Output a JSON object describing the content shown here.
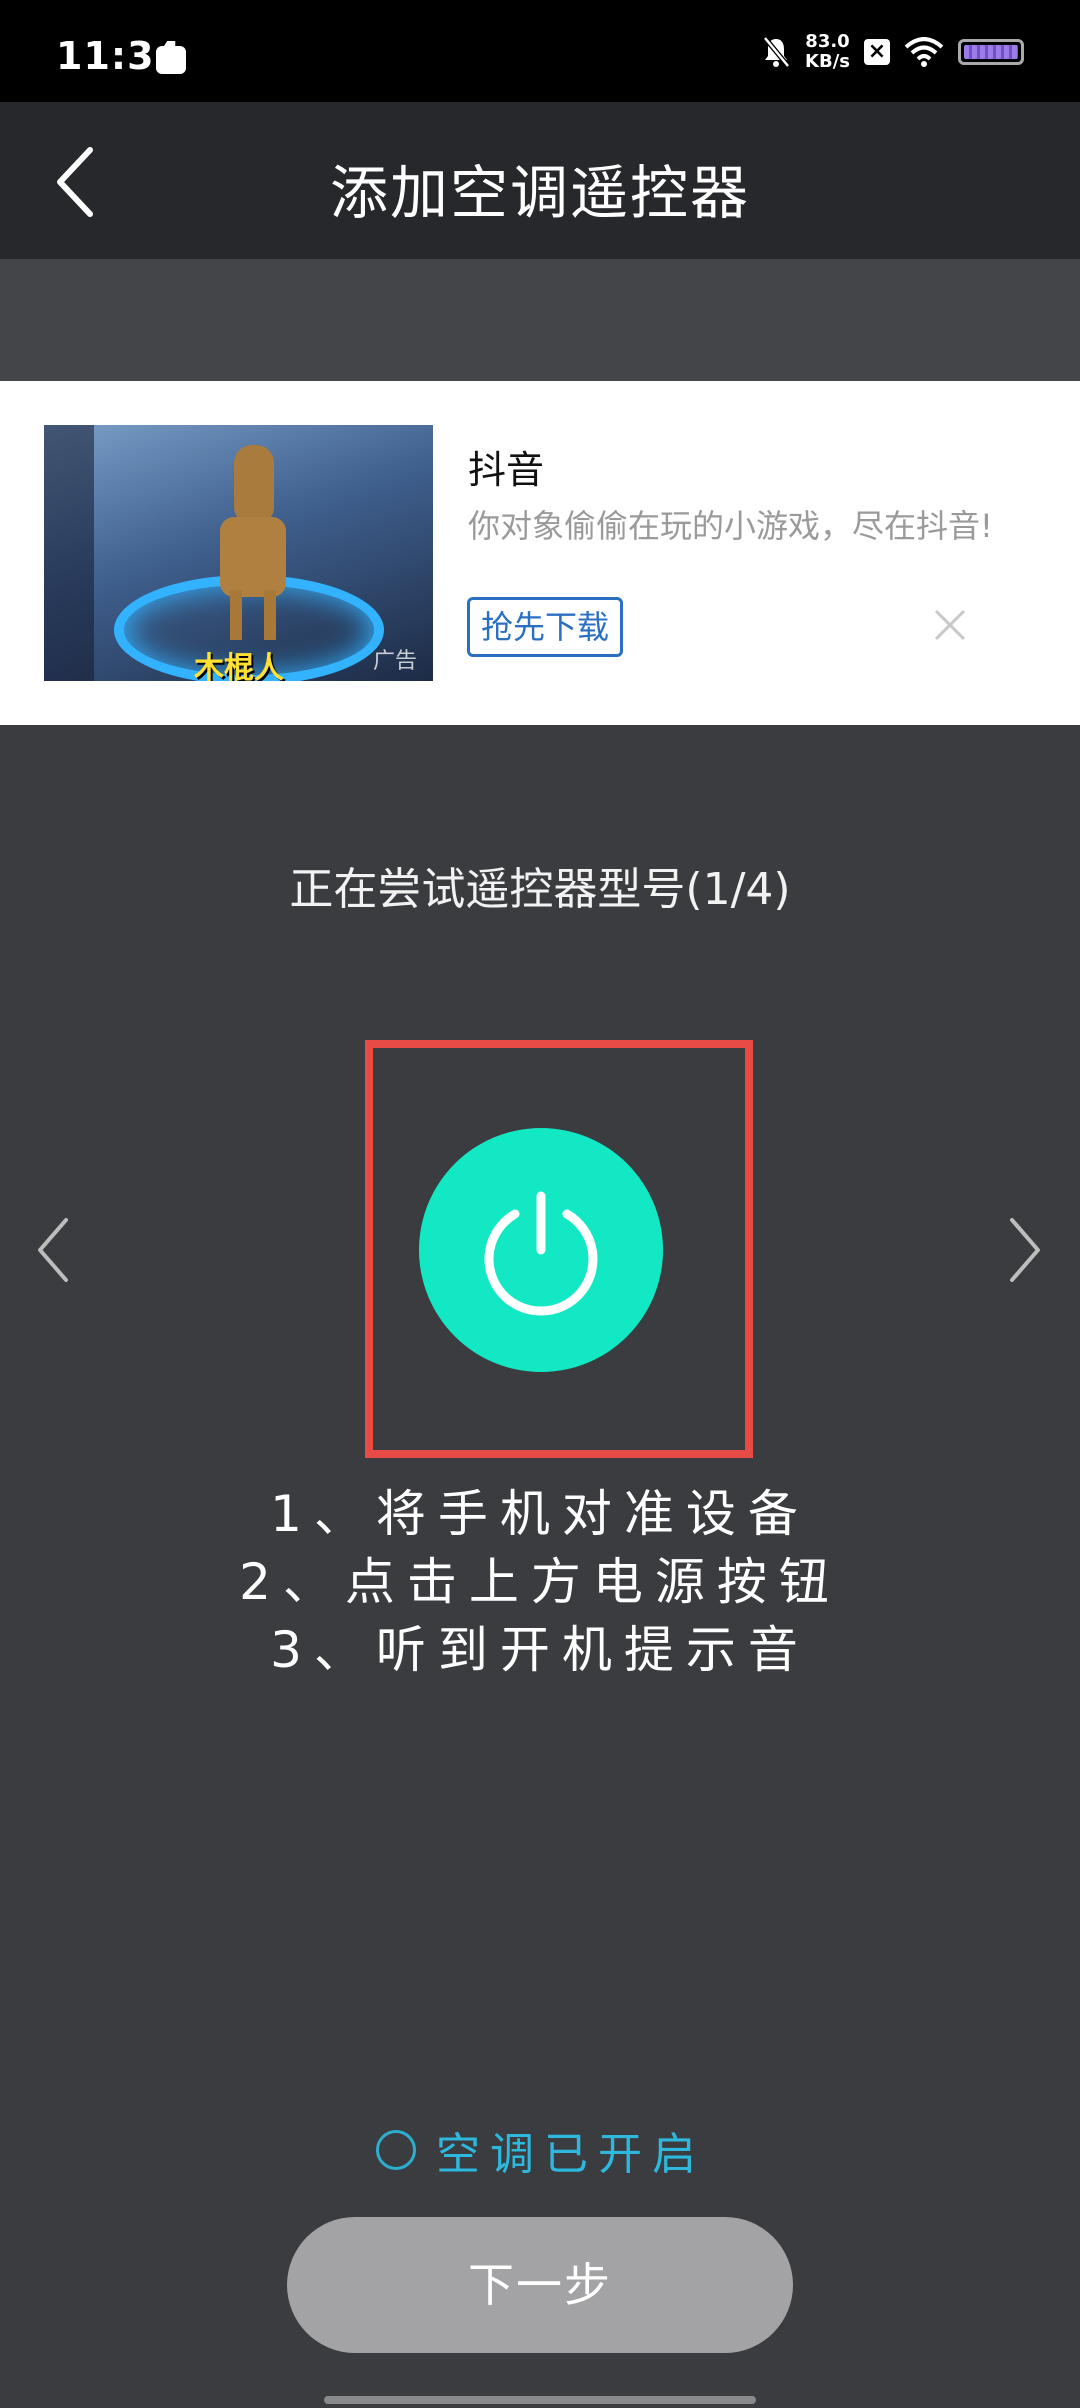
{
  "status_bar": {
    "time": "11:34",
    "net_speed_value": "83.0",
    "net_speed_unit": "KB/s"
  },
  "header": {
    "title": "添加空调遥控器"
  },
  "ad": {
    "image_caption": "木棍人",
    "image_tag": "广告",
    "app_name": "抖音",
    "description": "你对象偷偷在玩的小游戏，尽在抖音!",
    "download_label": "抢先下载"
  },
  "main": {
    "trying_label": "正在尝试遥控器型号(1/4)",
    "steps": [
      "1、将手机对准设备",
      "2、点击上方电源按钮",
      "3、听到开机提示音"
    ],
    "ac_on_label": "空调已开启",
    "next_label": "下一步"
  },
  "colors": {
    "power_button": "#12e8c3",
    "highlight_frame": "#e84a46",
    "accent": "#2eb8dd",
    "background": "#3b3c40"
  },
  "icons": {
    "back": "chevron-left-icon",
    "prev_model": "chevron-left-icon",
    "next_model": "chevron-right-icon",
    "power": "power-icon",
    "close_ad": "close-icon"
  }
}
